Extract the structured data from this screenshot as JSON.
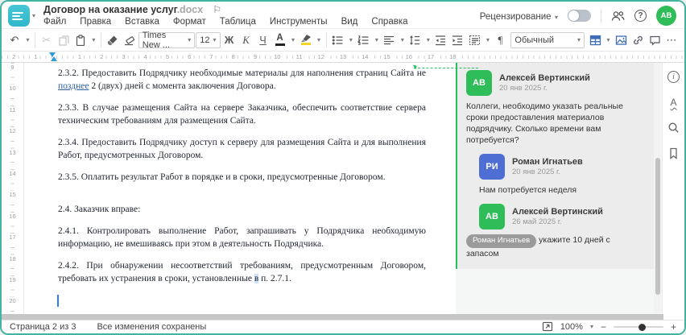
{
  "window_title": {
    "name": "Договор на оказание услуг",
    "ext": ".docx"
  },
  "menu": {
    "items": [
      "Файл",
      "Правка",
      "Вставка",
      "Формат",
      "Таблица",
      "Инструменты",
      "Вид",
      "Справка"
    ]
  },
  "topbar": {
    "review_label": "Рецензирование",
    "avatar_initials": "АВ"
  },
  "icons": {
    "caret": "▾",
    "undo": "↶",
    "cut": "✂",
    "flag": "⚐",
    "pilcrow": "¶",
    "more": "⋯",
    "help": "?",
    "info": "i",
    "spell_letter": "А",
    "minus": "−",
    "plus": "+"
  },
  "toolbar": {
    "font_name": "Times New ...",
    "font_size": "12",
    "bold_label": "Ж",
    "italic_label": "К",
    "underline_label": "Ч",
    "font_color_label": "А",
    "style_name": "Обычный"
  },
  "ruler": {
    "h_labels": [
      "2",
      "1",
      "1",
      "2",
      "3",
      "4",
      "5",
      "6",
      "7",
      "8",
      "9",
      "10",
      "11",
      "12",
      "13",
      "14",
      "15",
      "16",
      "17",
      "18"
    ],
    "v_labels": [
      "9",
      "10",
      "11",
      "12",
      "13",
      "14",
      "15",
      "16",
      "17",
      "18",
      "19",
      "20"
    ]
  },
  "document": {
    "p232_pre": "2.3.2. Предоставить Подрядчику необходимые материалы для наполнения страниц Сайта не ",
    "p232_ins": "позднее",
    "p232_post": " 2 (двух) дней с момента заключения Договора.",
    "p233": "2.3.3. В случае размещения Сайта на сервере Заказчика, обеспечить соответствие сервера техническим требованиям для размещения Сайта.",
    "p234": "2.3.4. Предоставить Подрядчику доступ к серверу для размещения Сайта и для выполнения Работ, предусмотренных Договором.",
    "p235": "2.3.5. Оплатить результат Работ в порядке и в сроки, предусмотренные Договором.",
    "p24": "2.4. Заказчик вправе:",
    "p241": "2.4.1. Контролировать выполнение Работ, запрашивать у Подрядчика необходимую информацию, не вмешиваясь при этом в деятельность Подрядчика.",
    "p242_pre": "2.4.2. При обнаружении несоответствий требованиям, предусмотренным Договором, требовать их устранения в сроки, установленные ",
    "p242_hl": "в",
    "p242_post": " п. 2.7.1."
  },
  "comments": [
    {
      "initials": "АВ",
      "name": "Алексей Вертинский",
      "date": "20 янв 2025 г.",
      "text": "Коллеги, необходимо указать реальные сроки предоставления материалов подрядчику. Сколько времени вам потребуется?"
    },
    {
      "initials": "РИ",
      "name": "Роман Игнатьев",
      "date": "20 янв 2025 г.",
      "text": "Нам потребуется неделя"
    },
    {
      "initials": "АВ",
      "name": "Алексей Вертинский",
      "date": "26 май 2025 г.",
      "mention": "Роман Игнатьев",
      "text": "укажите 10 дней с запасом"
    }
  ],
  "statusbar": {
    "page": "Страница 2 из 3",
    "saved": "Все изменения сохранены",
    "zoom": "100%"
  },
  "colors": {
    "accent_teal": "#43b3a2",
    "logo_cyan": "#3ec0d0",
    "comment_green": "#25bf5e",
    "avatar_green": "#2ebd59",
    "avatar_blue": "#4f6ed4",
    "ruler_marker_blue": "#2d9cdb",
    "insert_icon_blue": "#3e6db5"
  }
}
